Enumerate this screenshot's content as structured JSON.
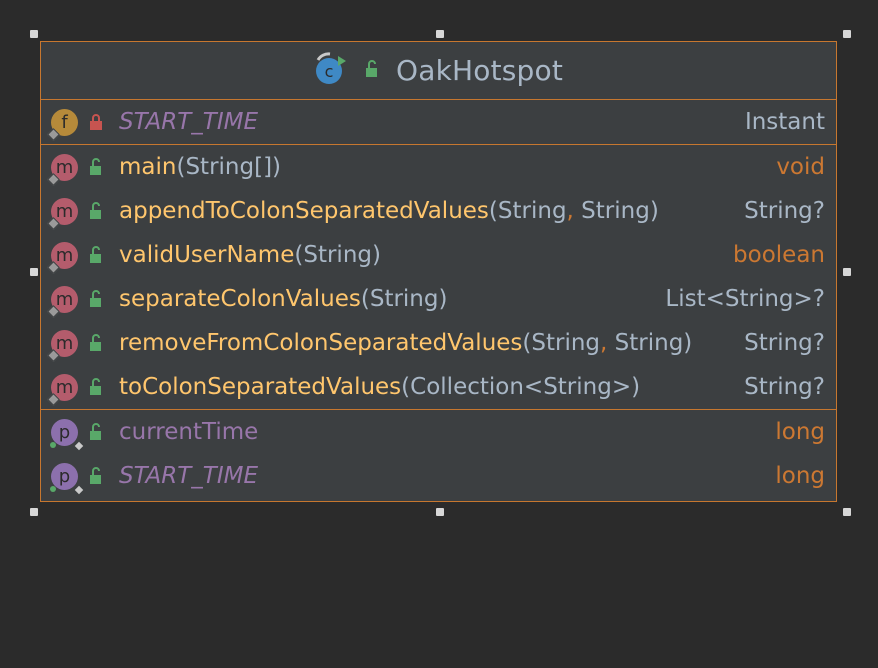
{
  "class_node": {
    "title": "OakHotspot",
    "class_icon": "class-icon",
    "visibility_icon": "unlocked-icon"
  },
  "fields": [
    {
      "name": "START_TIME",
      "type": "Instant",
      "badge": "f",
      "visibility": "private"
    }
  ],
  "methods": [
    {
      "name": "main",
      "open": "(",
      "args": "String[]",
      "close": ")",
      "type": "void",
      "type_kind": "keyword"
    },
    {
      "name": "appendToColonSeparatedValues",
      "open": "(",
      "arg1": "String",
      "sep": ",",
      "arg2": " String",
      "close": ")",
      "type": "String?",
      "type_kind": "class"
    },
    {
      "name": "validUserName",
      "open": "(",
      "args": "String",
      "close": ")",
      "type": "boolean",
      "type_kind": "keyword"
    },
    {
      "name": "separateColonValues",
      "open": "(",
      "args": "String",
      "close": ")",
      "type": "List<String>?",
      "type_kind": "class"
    },
    {
      "name": "removeFromColonSeparatedValues",
      "open": "(",
      "arg1": "String",
      "sep": ",",
      "arg2": " String",
      "close": ")",
      "type": "String?",
      "type_kind": "class"
    },
    {
      "name": "toColonSeparatedValues",
      "open": "(",
      "args": "Collection<String>",
      "close": ")",
      "type": "String?",
      "type_kind": "class"
    }
  ],
  "properties": [
    {
      "name": "currentTime",
      "type": "long",
      "badge": "p"
    },
    {
      "name": "START_TIME",
      "type": "long",
      "badge": "p"
    }
  ],
  "colors": {
    "background": "#2b2b2b",
    "node_fill": "#3c3f41",
    "border": "#c7772f",
    "method_name": "#ffc66d",
    "field_name": "#9876aa",
    "keyword": "#cc7832",
    "text": "#a9b7c6"
  }
}
